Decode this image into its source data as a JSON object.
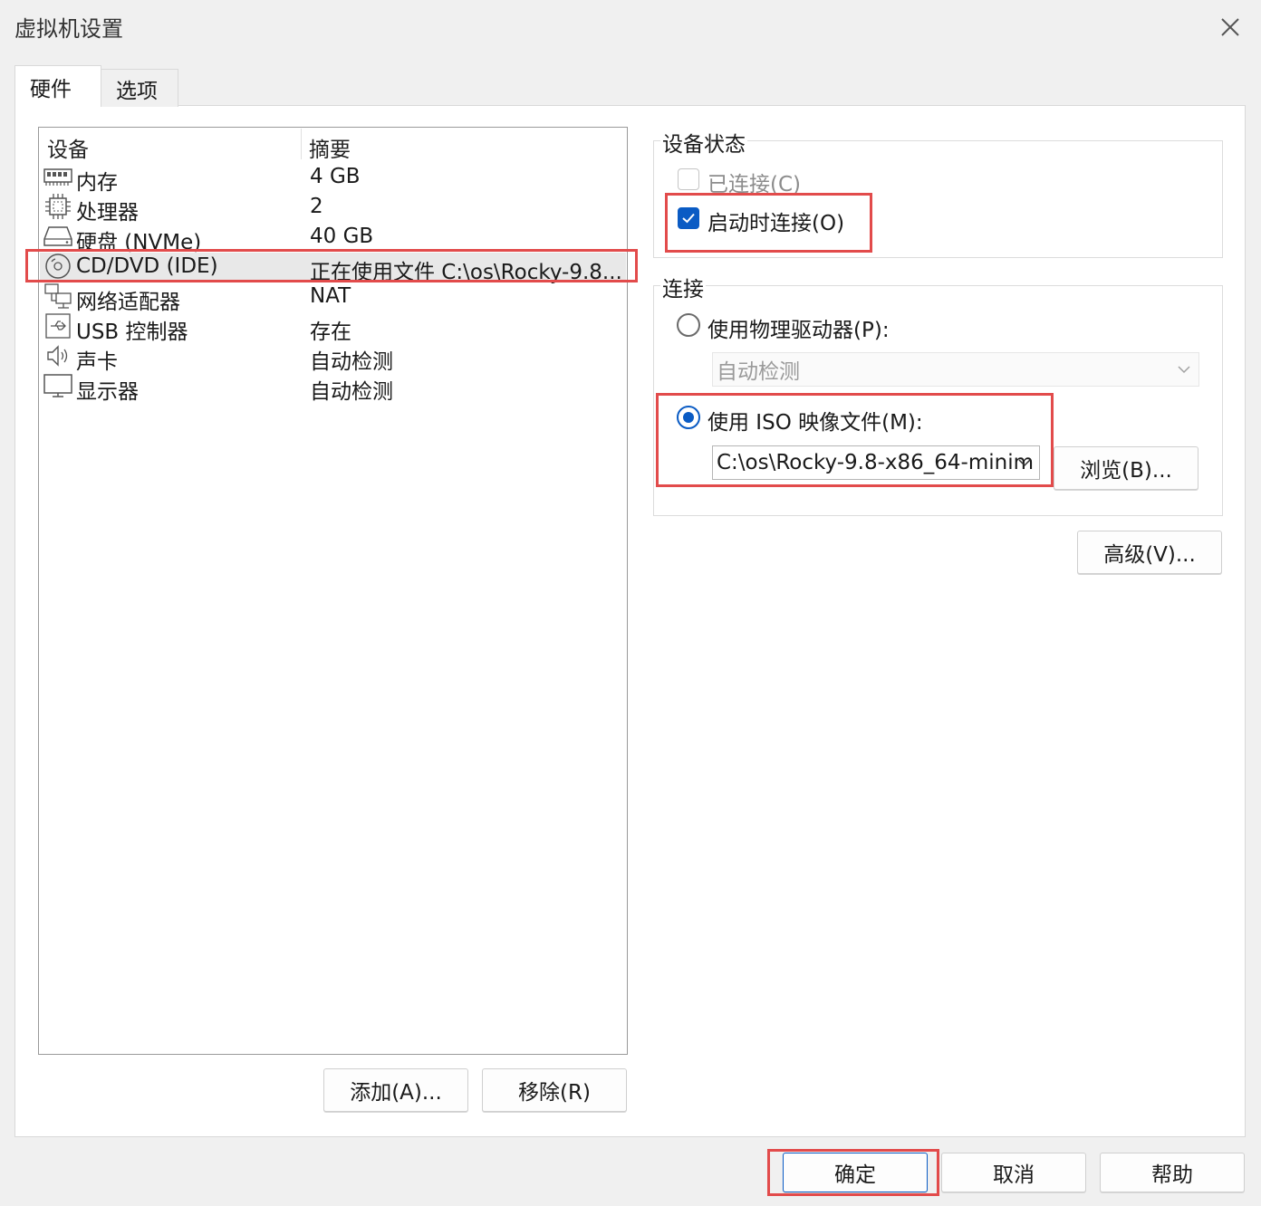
{
  "window": {
    "title": "虚拟机设置"
  },
  "tabs": [
    {
      "label": "硬件",
      "active": true
    },
    {
      "label": "选项",
      "active": false
    }
  ],
  "device_list": {
    "columns": [
      "设备",
      "摘要"
    ],
    "rows": [
      {
        "icon": "memory-icon",
        "name": "内存",
        "summary": "4 GB"
      },
      {
        "icon": "processor-icon",
        "name": "处理器",
        "summary": "2"
      },
      {
        "icon": "hard-disk-icon",
        "name": "硬盘 (NVMe)",
        "summary": "40 GB"
      },
      {
        "icon": "cd-dvd-icon",
        "name": "CD/DVD (IDE)",
        "summary": "正在使用文件 C:\\os\\Rocky-9.8...",
        "selected": true
      },
      {
        "icon": "network-adapter-icon",
        "name": "网络适配器",
        "summary": "NAT"
      },
      {
        "icon": "usb-icon",
        "name": "USB 控制器",
        "summary": "存在"
      },
      {
        "icon": "speaker-icon",
        "name": "声卡",
        "summary": "自动检测"
      },
      {
        "icon": "monitor-icon",
        "name": "显示器",
        "summary": "自动检测"
      }
    ]
  },
  "device_status": {
    "title": "设备状态",
    "connected_label": "已连接(C)",
    "connected_checked": false,
    "connect_at_power_on_label": "启动时连接(O)",
    "connect_at_power_on_checked": true
  },
  "connection": {
    "title": "连接",
    "physical_drive_label": "使用物理驱动器(P):",
    "physical_drive_value": "自动检测",
    "iso_label": "使用 ISO 映像文件(M):",
    "iso_path": "C:\\os\\Rocky-9.8-x86_64-minim",
    "browse_label": "浏览(B)..."
  },
  "advanced_label": "高级(V)...",
  "list_buttons": {
    "add": "添加(A)...",
    "remove": "移除(R)"
  },
  "footer": {
    "ok": "确定",
    "cancel": "取消",
    "help": "帮助"
  },
  "colors": {
    "accent": "#0a5bc4",
    "highlight": "#e24b4b"
  }
}
